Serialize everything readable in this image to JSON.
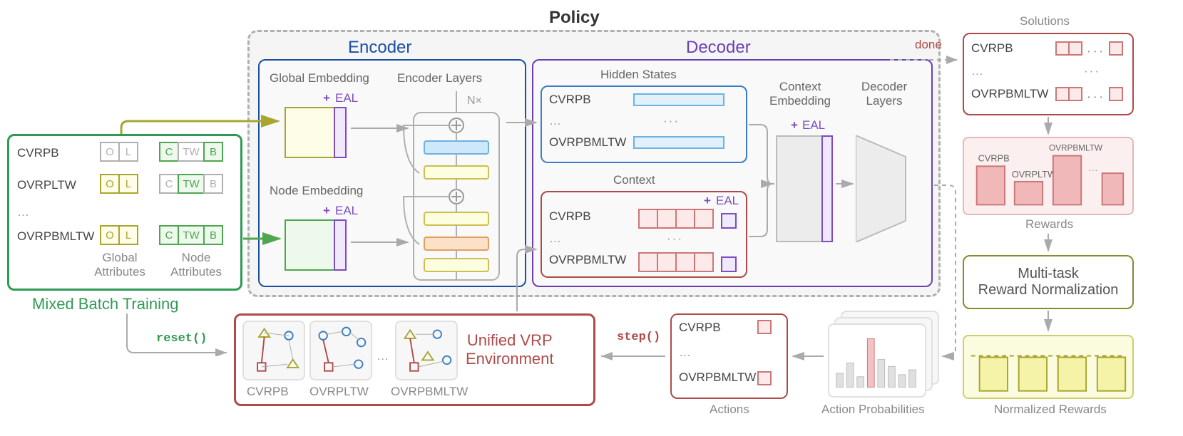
{
  "policy": {
    "title": "Policy",
    "encoder": {
      "title": "Encoder",
      "global_embedding": "Global Embedding",
      "node_embedding": "Node Embedding",
      "layers": "Encoder Layers",
      "eal": "EAL",
      "plus": "+",
      "nx": "N×"
    },
    "decoder": {
      "title": "Decoder",
      "hidden_states": "Hidden States",
      "context": "Context",
      "context_embedding": "Context\nEmbedding",
      "layers": "Decoder Layers",
      "eal": "EAL",
      "plus": "+"
    }
  },
  "mixed_batch": {
    "title": "Mixed Batch Training",
    "rows": [
      "CVRPB",
      "OVRPLTW",
      "…",
      "OVRPBMLTW"
    ],
    "global_attr_label": "Global\nAttributes",
    "node_attr_label": "Node\nAttributes",
    "attrs": [
      "O",
      "L",
      "C",
      "TW",
      "B"
    ]
  },
  "env": {
    "title": "Unified VRP\nEnvironment",
    "reset": "reset()",
    "step": "step()",
    "examples": [
      "CVRPB",
      "OVRPLTW",
      "…",
      "OVRPBMLTW"
    ]
  },
  "hidden": {
    "rows": [
      "CVRPB",
      "…",
      "OVRPBMLTW"
    ]
  },
  "context_rows": {
    "rows": [
      "CVRPB",
      "…",
      "OVRPBMLTW"
    ]
  },
  "actions": {
    "label": "Actions",
    "rows": [
      "CVRPB",
      "…",
      "OVRPBMLTW"
    ]
  },
  "action_probs": "Action Probabilities",
  "solutions": {
    "title": "Solutions",
    "rows": [
      "CVRPB",
      "…",
      "OVRPBMLTW"
    ],
    "done": "done"
  },
  "rewards": {
    "title": "Rewards",
    "bars": [
      "CVRPB",
      "OVRPLTW",
      "OVRPBMLTW",
      "…"
    ]
  },
  "reward_norm": "Multi-task\nReward Normalization",
  "norm_rewards": "Normalized Rewards"
}
